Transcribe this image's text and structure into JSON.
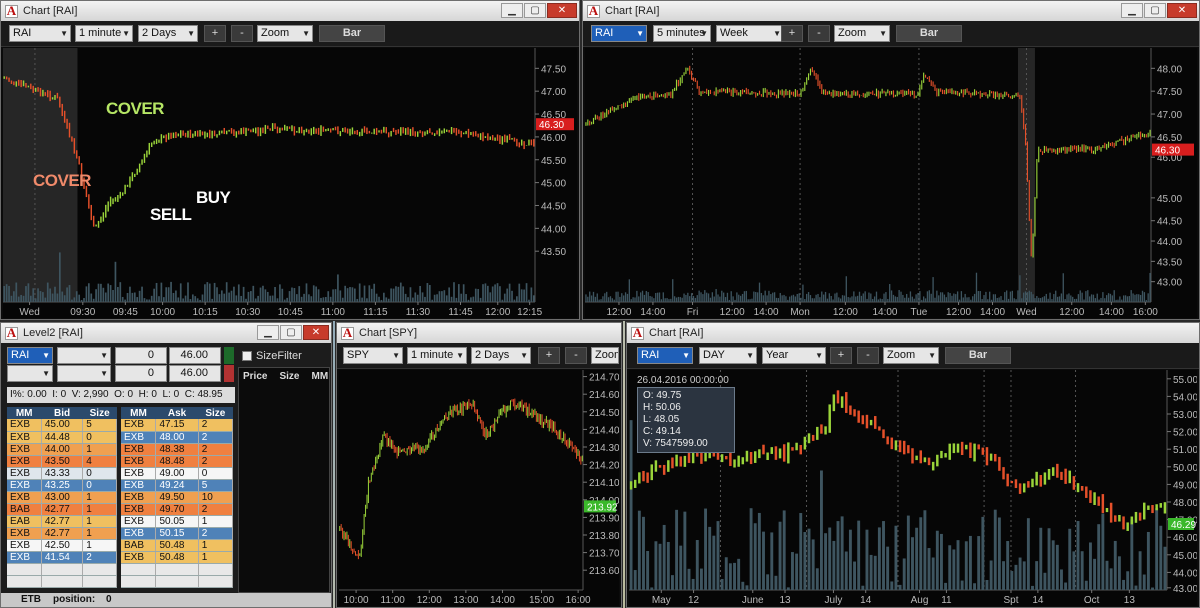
{
  "win1": {
    "title": "Chart [RAI]",
    "symbol": "RAI",
    "interval": "1 minute",
    "range": "2 Days",
    "plus": "+",
    "minus": "-",
    "zoom": "Zoom",
    "bar": "Bar",
    "price_ticks": [
      "47.50",
      "47.00",
      "46.50",
      "46.00",
      "45.50",
      "45.00",
      "44.50",
      "44.00",
      "43.50"
    ],
    "time_ticks": [
      "Wed",
      "09:30",
      "09:45",
      "10:00",
      "10:15",
      "10:30",
      "10:45",
      "11:00",
      "11:15",
      "11:30",
      "11:45",
      "12:00",
      "12:15"
    ],
    "last_price": "46.30",
    "annotations": {
      "cover1": "COVER",
      "cover2": "COVER",
      "sell": "SELL",
      "buy": "BUY"
    }
  },
  "win2": {
    "title": "Chart [RAI]",
    "symbol": "RAI",
    "interval": "5 minutes",
    "range": "Week",
    "plus": "+",
    "minus": "-",
    "zoom": "Zoom",
    "bar": "Bar",
    "price_ticks": [
      "48.00",
      "47.50",
      "47.00",
      "46.50",
      "46.00",
      "45.00",
      "44.50",
      "44.00",
      "43.50",
      "43.00"
    ],
    "time_ticks": [
      "12:00",
      "14:00",
      "Fri",
      "12:00",
      "14:00",
      "Mon",
      "12:00",
      "14:00",
      "Tue",
      "12:00",
      "14:00",
      "Wed",
      "12:00",
      "14:00",
      "16:00"
    ],
    "last_price": "46.30"
  },
  "win3": {
    "title": "Level2 [RAI]",
    "symbol": "RAI",
    "qty1": "0",
    "price1": "46.00",
    "qty2": "0",
    "price2": "46.00",
    "size_filter": "SizeFilter",
    "stats": "I%: 0.00  I: 0  V: 2,990  O: 0  H: 0  L: 0  C: 48.95",
    "log_headers": [
      "Price",
      "Size",
      "MM"
    ],
    "bid_headers": [
      "MM",
      "Bid",
      "Size"
    ],
    "ask_headers": [
      "MM",
      "Ask",
      "Size"
    ],
    "bids": [
      [
        "EXB",
        "45.00",
        "5"
      ],
      [
        "EXB",
        "44.48",
        "0"
      ],
      [
        "EXB",
        "44.00",
        "1"
      ],
      [
        "EXB",
        "43.50",
        "4"
      ],
      [
        "EXB",
        "43.33",
        "0"
      ],
      [
        "EXB",
        "43.25",
        "0"
      ],
      [
        "EXB",
        "43.00",
        "1"
      ],
      [
        "BAB",
        "42.77",
        "1"
      ],
      [
        "EAB",
        "42.77",
        "1"
      ],
      [
        "EXB",
        "42.77",
        "1"
      ],
      [
        "EXB",
        "42.50",
        "1"
      ],
      [
        "EXB",
        "41.54",
        "2"
      ]
    ],
    "asks": [
      [
        "EXB",
        "47.15",
        "2"
      ],
      [
        "EXB",
        "48.00",
        "2"
      ],
      [
        "EXB",
        "48.38",
        "2"
      ],
      [
        "EXB",
        "48.48",
        "2"
      ],
      [
        "EXB",
        "49.00",
        "0"
      ],
      [
        "EXB",
        "49.24",
        "5"
      ],
      [
        "EXB",
        "49.50",
        "10"
      ],
      [
        "EXB",
        "49.70",
        "2"
      ],
      [
        "EXB",
        "50.05",
        "1"
      ],
      [
        "EXB",
        "50.15",
        "2"
      ],
      [
        "BAB",
        "50.48",
        "1"
      ],
      [
        "EXB",
        "50.48",
        "1"
      ]
    ],
    "footer_label": "ETB",
    "position_label": "position:",
    "position_value": "0"
  },
  "win4": {
    "title": "Chart [SPY]",
    "symbol": "SPY",
    "interval": "1 minute",
    "range": "2 Days",
    "plus": "+",
    "minus": "-",
    "zoom": "Zoom",
    "price_ticks": [
      "214.70",
      "214.60",
      "214.50",
      "214.40",
      "214.30",
      "214.20",
      "214.10",
      "214.00",
      "213.90",
      "213.80",
      "213.70",
      "213.60"
    ],
    "time_ticks": [
      "10:00",
      "11:00",
      "12:00",
      "13:00",
      "14:00",
      "15:00",
      "16:00"
    ],
    "last_price": "213.92"
  },
  "win5": {
    "title": "Chart [RAI]",
    "symbol": "RAI",
    "interval": "DAY",
    "range": "Year",
    "plus": "+",
    "minus": "-",
    "zoom": "Zoom",
    "bar": "Bar",
    "price_ticks": [
      "55.00",
      "54.00",
      "53.00",
      "52.00",
      "51.00",
      "50.00",
      "49.00",
      "48.00",
      "47.00",
      "46.00",
      "45.00",
      "44.00",
      "43.00"
    ],
    "time_ticks": [
      "May",
      "12",
      "June",
      "13",
      "July",
      "14",
      "Aug",
      "11",
      "Spt",
      "14",
      "Oct",
      "13"
    ],
    "last_price": "46.29",
    "tooltip": {
      "date": "26.04.2016 00:00:00",
      "o": "O: 49.75",
      "h": "H: 50.06",
      "l": "L: 48.05",
      "c": "C: 49.14",
      "v": "V: 7547599.00"
    }
  },
  "colors": {
    "up": "#9ad43a",
    "down": "#e5502a",
    "last_red": "#d81e1e",
    "last_green": "#3bb82b"
  }
}
